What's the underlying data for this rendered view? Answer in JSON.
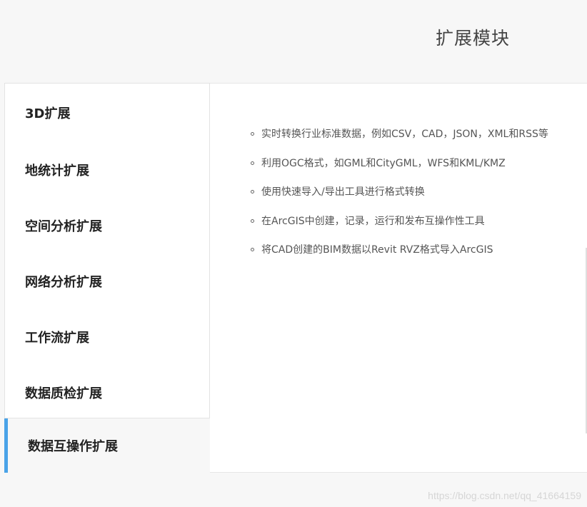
{
  "header": {
    "title": "扩展模块"
  },
  "tabs": [
    {
      "label": "3D扩展",
      "active": false
    },
    {
      "label": "地统计扩展",
      "active": false
    },
    {
      "label": "空间分析扩展",
      "active": false
    },
    {
      "label": "网络分析扩展",
      "active": false
    },
    {
      "label": "工作流扩展",
      "active": false
    },
    {
      "label": "数据质检扩展",
      "active": false
    },
    {
      "label": "数据互操作扩展",
      "active": true
    }
  ],
  "content": {
    "items": [
      "实时转换行业标准数据，例如CSV，CAD，JSON，XML和RSS等",
      "利用OGC格式，如GML和CityGML，WFS和KML/KMZ",
      "使用快速导入/导出工具进行格式转换",
      "在ArcGIS中创建，记录，运行和发布互操作性工具",
      "将CAD创建的BIM数据以Revit RVZ格式导入ArcGIS"
    ]
  },
  "colors": {
    "accent": "#4aa3e8",
    "page_background": "#f7f7f7",
    "panel_background": "#ffffff"
  },
  "watermark": "https://blog.csdn.net/qq_41664159"
}
